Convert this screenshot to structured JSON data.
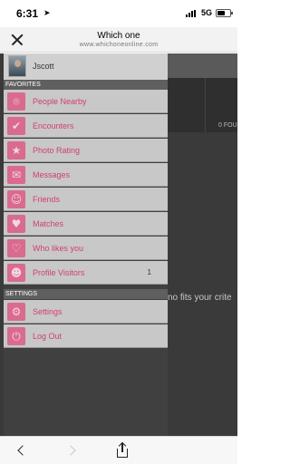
{
  "status_bar": {
    "time": "6:31",
    "location_icon": "location-arrow-icon",
    "network": "5G",
    "battery_level": 0.6
  },
  "browser": {
    "title": "Which one",
    "url": "www.whichoneonline.com"
  },
  "background": {
    "count_label": "0 FOU",
    "message": "no fits your crite"
  },
  "drawer": {
    "user": {
      "name": "Jscott"
    },
    "sections": {
      "favorites": "FAVORITES",
      "settings": "SETTINGS"
    },
    "favorites": [
      {
        "label": "People Nearby",
        "icon": "location-pin-icon"
      },
      {
        "label": "Encounters",
        "icon": "checkmark-icon"
      },
      {
        "label": "Photo Rating",
        "icon": "star-icon"
      },
      {
        "label": "Messages",
        "icon": "chat-bubble-icon"
      },
      {
        "label": "Friends",
        "icon": "smiley-icon"
      },
      {
        "label": "Matches",
        "icon": "heart-icon"
      },
      {
        "label": "Who likes you",
        "icon": "location-heart-icon"
      },
      {
        "label": "Profile Visitors",
        "icon": "visitor-icon",
        "badge": "1"
      }
    ],
    "settings_items": [
      {
        "label": "Settings",
        "icon": "gear-icon"
      },
      {
        "label": "Log Out",
        "icon": "power-icon"
      }
    ]
  },
  "colors": {
    "accent": "#d96b8e",
    "label": "#d0406e",
    "drawer_bg": "#404040",
    "item_bg": "#c8c8c8"
  }
}
